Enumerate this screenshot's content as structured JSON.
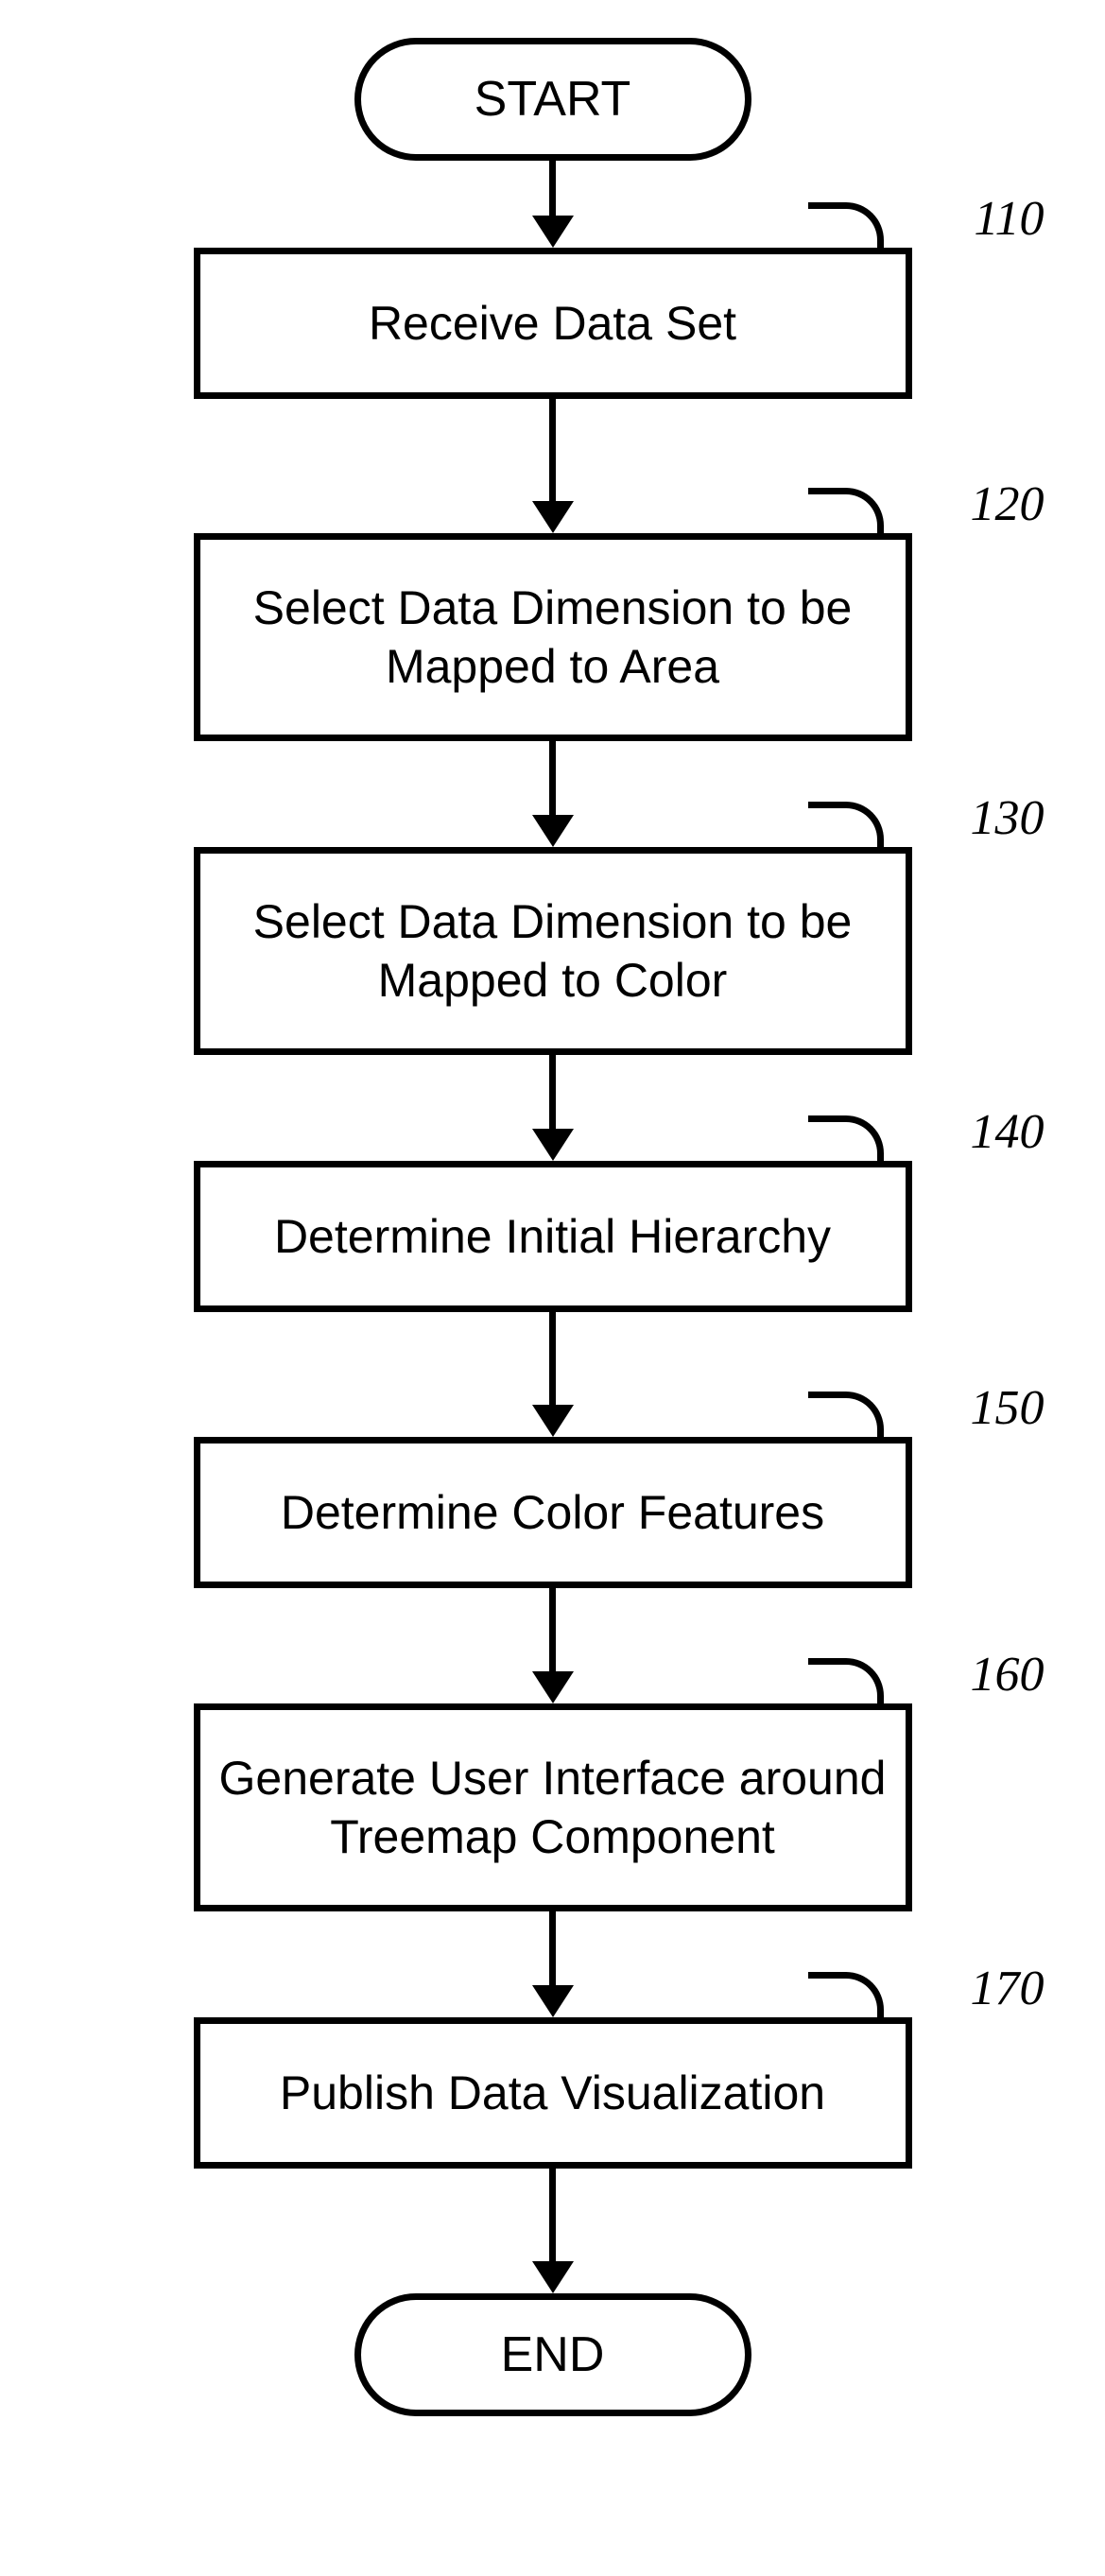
{
  "terminators": {
    "start": "START",
    "end": "END"
  },
  "steps": [
    {
      "id": "110",
      "label": "Receive Data Set",
      "lines": 1
    },
    {
      "id": "120",
      "label": "Select Data Dimension to be\nMapped to Area",
      "lines": 2
    },
    {
      "id": "130",
      "label": "Select Data Dimension to be\nMapped to Color",
      "lines": 2
    },
    {
      "id": "140",
      "label": "Determine Initial Hierarchy",
      "lines": 1
    },
    {
      "id": "150",
      "label": "Determine Color Features",
      "lines": 1
    },
    {
      "id": "160",
      "label": "Generate User Interface around\nTreemap Component",
      "lines": 2
    },
    {
      "id": "170",
      "label": "Publish Data Visualization",
      "lines": 1
    }
  ]
}
